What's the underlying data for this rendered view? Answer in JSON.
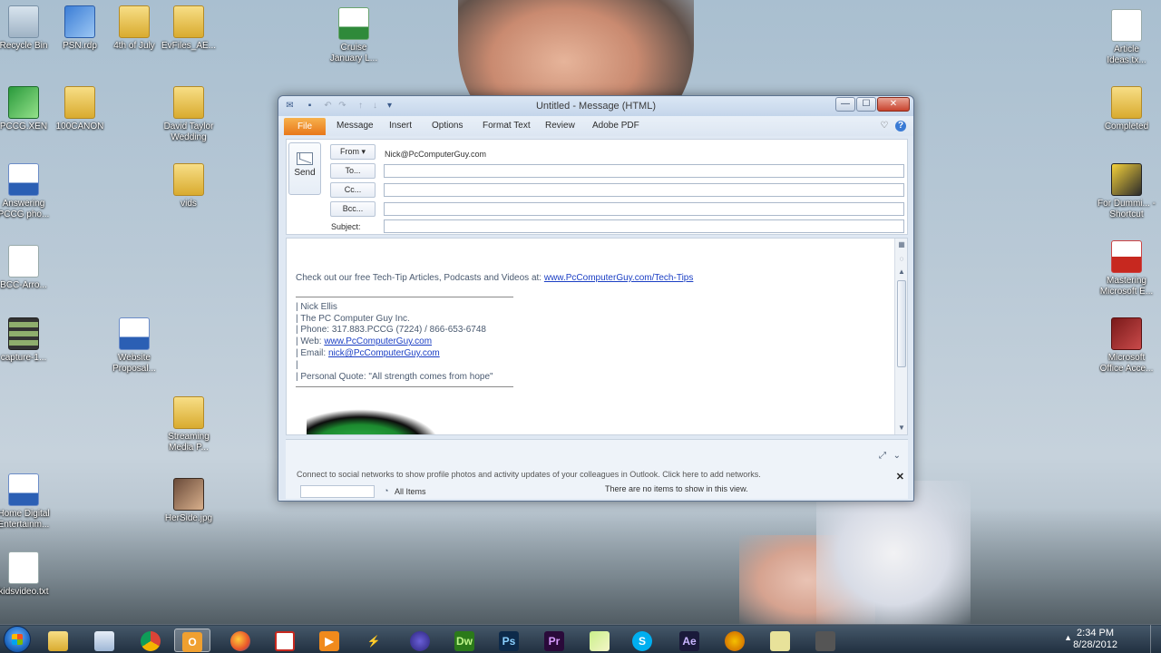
{
  "desktop": {
    "icons": [
      {
        "label": "Recycle Bin",
        "glyph": "recycle-bin-icon"
      },
      {
        "label": "PSN.rdp",
        "glyph": "remote-desktop-icon"
      },
      {
        "label": "4th of July",
        "glyph": "folder-icon"
      },
      {
        "label": "EvFiles_AE...",
        "glyph": "folder-icon"
      },
      {
        "label": "Cruise January L...",
        "glyph": "excel-file-icon"
      },
      {
        "label": "Article Ideas.tx...",
        "glyph": "text-file-icon"
      },
      {
        "label": "PCCG.XEN",
        "glyph": "app-icon"
      },
      {
        "label": "100CANON",
        "glyph": "folder-icon"
      },
      {
        "label": "David Taylor Wedding",
        "glyph": "folder-icon"
      },
      {
        "label": "Completed",
        "glyph": "folder-icon"
      },
      {
        "label": "Answering PCCG pho...",
        "glyph": "word-file-icon"
      },
      {
        "label": "vids",
        "glyph": "folder-icon"
      },
      {
        "label": "For Dummi... - Shortcut",
        "glyph": "book-shortcut-icon"
      },
      {
        "label": "BCC-Arro...",
        "glyph": "image-file-icon"
      },
      {
        "label": "Mastering Microsoft E...",
        "glyph": "pdf-file-icon"
      },
      {
        "label": "capture-1...",
        "glyph": "video-file-icon"
      },
      {
        "label": "Website Proposal...",
        "glyph": "word-file-icon"
      },
      {
        "label": "Microsoft Office Acce...",
        "glyph": "access-icon"
      },
      {
        "label": "Streaming Media P...",
        "glyph": "folder-icon"
      },
      {
        "label": "Home Digital Entertainm...",
        "glyph": "word-file-icon"
      },
      {
        "label": "HerSide.jpg",
        "glyph": "image-file-icon"
      },
      {
        "label": "kidsvideo.txt",
        "glyph": "text-file-icon"
      }
    ]
  },
  "window": {
    "title": "Untitled - Message (HTML)",
    "controls": {
      "minimize": "—",
      "maximize": "☐",
      "close": "✕"
    }
  },
  "ribbon": {
    "tabs": [
      "File",
      "Message",
      "Insert",
      "Options",
      "Format Text",
      "Review",
      "Adobe PDF"
    ]
  },
  "compose": {
    "send_label": "Send",
    "from_label": "From ▾",
    "from_value": "Nick@PcComputerGuy.com",
    "to_label": "To...",
    "cc_label": "Cc...",
    "bcc_label": "Bcc...",
    "subject_label": "Subject:",
    "to_value": "",
    "cc_value": "",
    "bcc_value": "",
    "subject_value": ""
  },
  "body": {
    "intro": "Check out our free Tech-Tip Articles, Podcasts and Videos at:",
    "intro_link": "www.PcComputerGuy.com/Tech-Tips",
    "sig_name": "| Nick Ellis",
    "sig_company": "| The PC Computer Guy Inc.",
    "sig_phone": "| Phone: 317.883.PCCG (7224) /  866-653-6748",
    "sig_web_label": "| Web:",
    "sig_web_link": "www.PcComputerGuy.com",
    "sig_email_label": "| Email:",
    "sig_email_link": "nick@PcComputerGuy.com",
    "sig_blank": "|",
    "sig_quote": "| Personal Quote: \"All strength comes from hope\""
  },
  "people_pane": {
    "social_text": "Connect to social networks to show profile photos and activity updates of your colleagues in Outlook. Click here to add networks.",
    "all_items": "All Items",
    "no_items": "There are no items to show in this view."
  },
  "taskbar": {
    "apps": [
      {
        "name": "explorer",
        "label": ""
      },
      {
        "name": "folders",
        "label": ""
      },
      {
        "name": "chrome",
        "label": ""
      },
      {
        "name": "outlook",
        "label": "O"
      },
      {
        "name": "firefox",
        "label": ""
      },
      {
        "name": "acrobat",
        "label": ""
      },
      {
        "name": "media",
        "label": "▶"
      },
      {
        "name": "utility",
        "label": "⚡"
      },
      {
        "name": "eclipse",
        "label": ""
      },
      {
        "name": "dreamweaver",
        "label": "Dw"
      },
      {
        "name": "photoshop",
        "label": "Ps"
      },
      {
        "name": "premiere",
        "label": "Pr"
      },
      {
        "name": "notes",
        "label": ""
      },
      {
        "name": "skype",
        "label": "S"
      },
      {
        "name": "after-effects",
        "label": "Ae"
      },
      {
        "name": "audio",
        "label": ""
      },
      {
        "name": "sticky",
        "label": ""
      },
      {
        "name": "tools",
        "label": ""
      }
    ],
    "clock_time": "2:34 PM",
    "clock_date": "8/28/2012"
  },
  "colors": {
    "file_tab": "#e8771a",
    "link": "#1b3fc4",
    "taskbar": "#1d3046"
  }
}
